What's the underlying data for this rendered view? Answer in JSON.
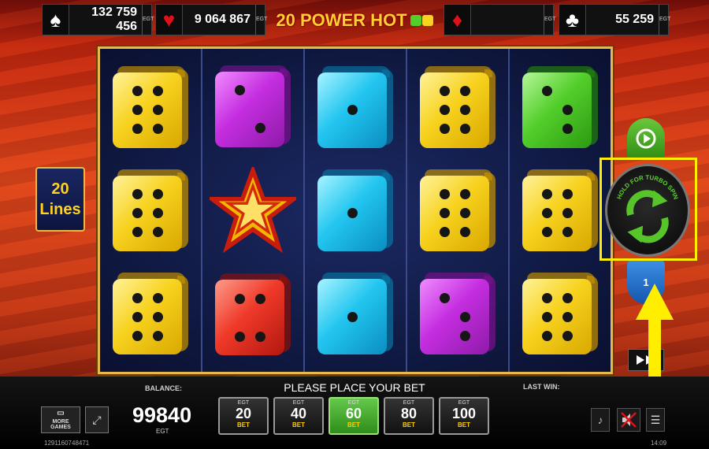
{
  "jackpots": [
    {
      "suit": "spade",
      "glyph": "♠",
      "amount": "132 759 456",
      "tag": "EGT",
      "color": "#ffffff"
    },
    {
      "suit": "heart",
      "glyph": "♥",
      "amount": "9 064 867",
      "tag": "EGT",
      "color": "#e0101a"
    },
    {
      "suit": "diamond",
      "glyph": "♦",
      "amount": "",
      "tag": "EGT",
      "color": "#e0101a"
    },
    {
      "suit": "club",
      "glyph": "♣",
      "amount": "55 259",
      "tag": "EGT",
      "color": "#ffffff"
    }
  ],
  "logo": {
    "text": "20 POWER HOT"
  },
  "lines": {
    "count": "20",
    "label": "Lines"
  },
  "reels": [
    [
      {
        "type": "die",
        "color": "yellow",
        "pips": 6
      },
      {
        "type": "die",
        "color": "yellow",
        "pips": 6
      },
      {
        "type": "die",
        "color": "yellow",
        "pips": 6
      }
    ],
    [
      {
        "type": "die",
        "color": "purple",
        "pips": 2
      },
      {
        "type": "star"
      },
      {
        "type": "die",
        "color": "red",
        "pips": 4
      }
    ],
    [
      {
        "type": "die",
        "color": "cyan",
        "pips": 1
      },
      {
        "type": "die",
        "color": "cyan",
        "pips": 1
      },
      {
        "type": "die",
        "color": "cyan",
        "pips": 1
      }
    ],
    [
      {
        "type": "die",
        "color": "yellow",
        "pips": 6
      },
      {
        "type": "die",
        "color": "yellow",
        "pips": 6
      },
      {
        "type": "die",
        "color": "purple",
        "pips": 3
      }
    ],
    [
      {
        "type": "die",
        "color": "green",
        "pips": 3
      },
      {
        "type": "die",
        "color": "yellow",
        "pips": 6
      },
      {
        "type": "die",
        "color": "yellow",
        "pips": 6
      }
    ]
  ],
  "spin_button": {
    "hint": "HOLD FOR TURBO SPIN"
  },
  "stake_button": {
    "label": "1"
  },
  "bottom": {
    "balance_label": "BALANCE:",
    "balance_value": "99840",
    "balance_currency": "EGT",
    "message": "PLEASE PLACE YOUR BET",
    "last_win_label": "LAST WIN:",
    "more_games_label": "MORE GAMES",
    "ticket_id": "1291160748471",
    "time": "14:09"
  },
  "bets": [
    {
      "tag": "EGT",
      "value": "20",
      "label": "BET",
      "selected": false
    },
    {
      "tag": "EGT",
      "value": "40",
      "label": "BET",
      "selected": false
    },
    {
      "tag": "EGT",
      "value": "60",
      "label": "BET",
      "selected": true
    },
    {
      "tag": "EGT",
      "value": "80",
      "label": "BET",
      "selected": false
    },
    {
      "tag": "EGT",
      "value": "100",
      "label": "BET",
      "selected": false
    }
  ],
  "colors": {
    "highlight": "#ffee00",
    "frame": "#e6b94a",
    "reel_bg": "#101a44"
  }
}
